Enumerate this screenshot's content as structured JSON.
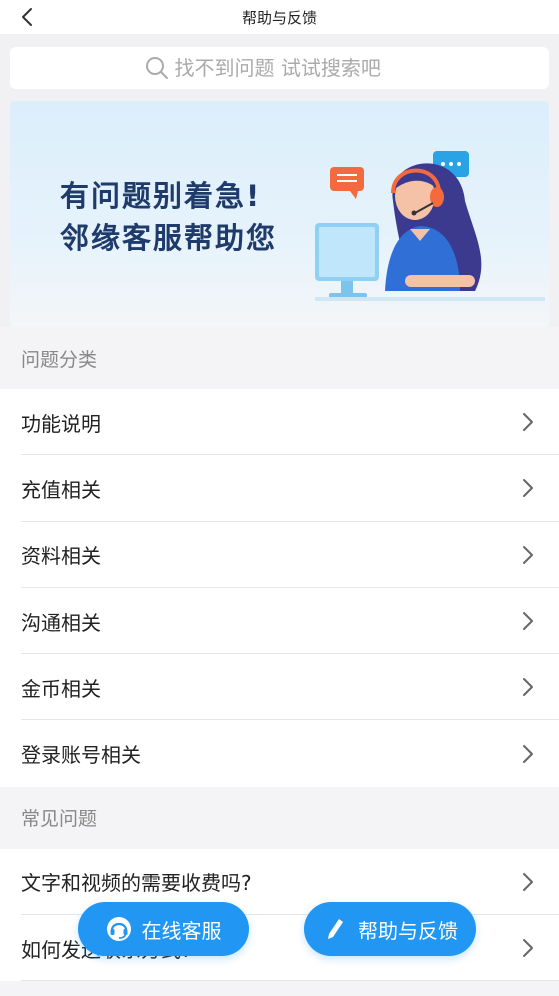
{
  "nav": {
    "title": "帮助与反馈",
    "back_icon": "chevron-left-icon"
  },
  "search": {
    "placeholder": "找不到问题 试试搜索吧",
    "icon": "search-icon"
  },
  "banner": {
    "line1": "有问题别着急!",
    "line2": "邻缘客服帮助您",
    "illustration": "customer-service-agent-illustration"
  },
  "categories": {
    "title": "问题分类",
    "items": [
      {
        "label": "功能说明"
      },
      {
        "label": "充值相关"
      },
      {
        "label": "资料相关"
      },
      {
        "label": "沟通相关"
      },
      {
        "label": "金币相关"
      },
      {
        "label": "登录账号相关"
      }
    ]
  },
  "faq": {
    "title": "常见问题",
    "items": [
      {
        "label": "文字和视频的需要收费吗?"
      },
      {
        "label": "如何发送联系方式?"
      }
    ]
  },
  "actions": {
    "online_service": {
      "label": "在线客服",
      "icon": "headset-icon"
    },
    "help_feedback": {
      "label": "帮助与反馈",
      "icon": "pencil-icon"
    }
  },
  "colors": {
    "accent": "#2196f3",
    "banner_text": "#1f3b6b"
  }
}
